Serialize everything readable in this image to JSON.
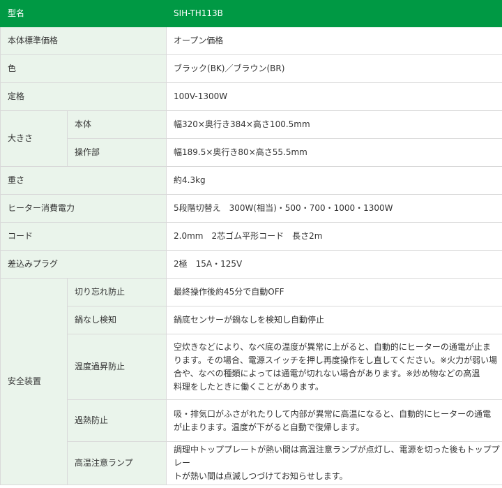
{
  "header": {
    "label": "型名",
    "value": "SIH-TH113B"
  },
  "price": {
    "label": "本体標準価格",
    "value": "オープン価格"
  },
  "color": {
    "label": "色",
    "value": "ブラック(BK)／ブラウン(BR)"
  },
  "rating": {
    "label": "定格",
    "value": "100V-1300W"
  },
  "size": {
    "label": "大きさ",
    "body": {
      "label": "本体",
      "value": "幅320×奥行き384×高さ100.5mm"
    },
    "control": {
      "label": "操作部",
      "value": "幅189.5×奥行き80×高さ55.5mm"
    }
  },
  "weight": {
    "label": "重さ",
    "value": "約4.3kg"
  },
  "power": {
    "label": "ヒーター消費電力",
    "value": "5段階切替え　300W(相当)・500・700・1000・1300W"
  },
  "cord": {
    "label": "コード",
    "value": "2.0mm　2芯ゴム平形コード　長さ2m"
  },
  "plug": {
    "label": "差込みプラグ",
    "value": "2極　15A・125V"
  },
  "safety": {
    "label": "安全装置",
    "autooff": {
      "label": "切り忘れ防止",
      "value": "最終操作後約45分で自動OFF"
    },
    "nopan": {
      "label": "鍋なし検知",
      "value": "鍋底センサーが鍋なしを検知し自動停止"
    },
    "overtemp": {
      "label": "温度過昇防止",
      "line1": "空炊きなどにより、なべ底の温度が異常に上がると、自動的にヒーターの通電が止ま",
      "line2": "ります。その場合、電源スイッチを押し再度操作をし直してください。※火力が弱い場",
      "line3": "合や、なべの種類によっては通電が切れない場合があります。※炒め物などの高温",
      "line4": "料理をしたときに働くことがあります。"
    },
    "overheat": {
      "label": "過熱防止",
      "line1": "吸・排気口がふさがれたりして内部が異常に高温になると、自動的にヒーターの通電",
      "line2": "が止まります。温度が下がると自動で復帰します。"
    },
    "lamp": {
      "label": "高温注意ランプ",
      "line1": "調理中トッププレートが熱い間は高温注意ランプが点灯し、電源を切った後もトッププレー",
      "line2": "トが熱い間は点滅しつづけてお知らせします。"
    }
  }
}
